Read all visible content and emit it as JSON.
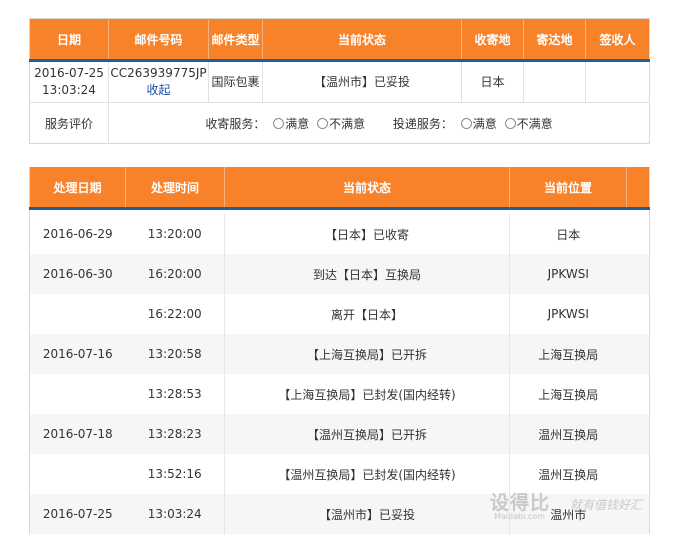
{
  "summary": {
    "headers": [
      "日期",
      "邮件号码",
      "邮件类型",
      "当前状态",
      "收寄地",
      "寄达地",
      "签收人"
    ],
    "row": {
      "date": "2016-07-25 13:03:24",
      "mail_number": "CC263939775JP",
      "collect_link": "收起",
      "mail_type": "国际包裹",
      "status": "【温州市】已妥投",
      "origin": "日本",
      "destination": "",
      "recipient": ""
    },
    "evaluation": {
      "label": "服务评价",
      "pickup_label": "收寄服务：",
      "delivery_label": "投递服务：",
      "satisfied": "满意",
      "unsatisfied": "不满意"
    }
  },
  "tracking": {
    "headers": [
      "处理日期",
      "处理时间",
      "当前状态",
      "当前位置"
    ],
    "rows": [
      {
        "date": "2016-06-29",
        "time": "13:20:00",
        "status": "【日本】已收寄",
        "location": "日本"
      },
      {
        "date": "2016-06-30",
        "time": "16:20:00",
        "status": "到达【日本】互换局",
        "location": "JPKWSI"
      },
      {
        "date": "",
        "time": "16:22:00",
        "status": "离开【日本】",
        "location": "JPKWSI"
      },
      {
        "date": "2016-07-16",
        "time": "13:20:58",
        "status": "【上海互换局】已开拆",
        "location": "上海互换局"
      },
      {
        "date": "",
        "time": "13:28:53",
        "status": "【上海互换局】已封发(国内经转)",
        "location": "上海互换局"
      },
      {
        "date": "2016-07-18",
        "time": "13:28:23",
        "status": "【温州互换局】已开拆",
        "location": "温州互换局"
      },
      {
        "date": "",
        "time": "13:52:16",
        "status": "【温州互换局】已封发(国内经转)",
        "location": "温州互换局"
      },
      {
        "date": "2016-07-25",
        "time": "13:03:24",
        "status": "【温州市】已妥投",
        "location": "温州市"
      }
    ]
  },
  "watermark": {
    "main": "设得比",
    "site": "Maidabi.com",
    "slogan": "就有值钱好汇"
  },
  "colors": {
    "header_bg": "#f7822a",
    "header_underline": "#1f5f9f",
    "link": "#1a4fa6"
  }
}
